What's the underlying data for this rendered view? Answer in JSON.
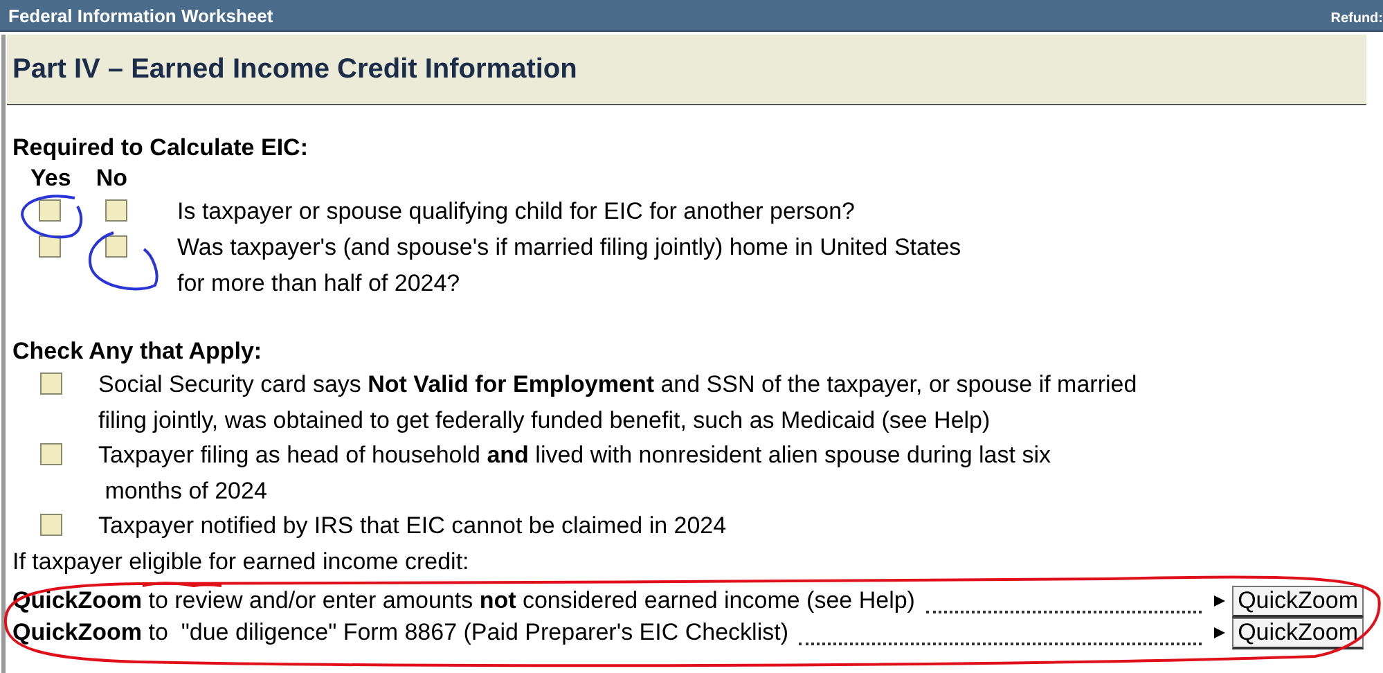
{
  "window": {
    "title": "Federal Information Worksheet",
    "refund_label": "Refund:"
  },
  "section": {
    "title": "Part IV – Earned Income Credit Information"
  },
  "required": {
    "heading": "Required to Calculate EIC:",
    "columns": [
      "Yes",
      "No"
    ],
    "questions": [
      {
        "lines": [
          "Is taxpayer or spouse qualifying child for EIC for another person?"
        ],
        "yes_checked": false,
        "no_checked": false
      },
      {
        "lines": [
          "Was taxpayer's (and spouse's if married filing jointly) home in United States",
          "for more than half of 2024?"
        ],
        "yes_checked": false,
        "no_checked": false
      }
    ]
  },
  "check_any": {
    "heading": "Check Any that Apply:",
    "items": [
      {
        "lines": [
          "Social Security card says **Not Valid for Employment** and SSN of the taxpayer, or spouse if married",
          "filing jointly, was obtained to get federally funded benefit, such as Medicaid (see Help)"
        ],
        "checked": false
      },
      {
        "lines": [
          "Taxpayer filing as head of household **and** lived with nonresident alien spouse during last six",
          " months of 2024"
        ],
        "checked": false
      },
      {
        "lines": [
          "Taxpayer notified by IRS that EIC cannot be claimed in 2024"
        ],
        "checked": false
      }
    ]
  },
  "eligible_note": "If taxpayer eligible for earned income credit:",
  "quickzoom_rows": [
    {
      "text": "**QuickZoom** to review and/or enter amounts **not** considered earned income (see Help)",
      "button": "QuickZoom"
    },
    {
      "text": "**QuickZoom** to  \"due diligence\" Form 8867 (Paid Preparer's EIC Checklist)",
      "button": "QuickZoom"
    }
  ]
}
